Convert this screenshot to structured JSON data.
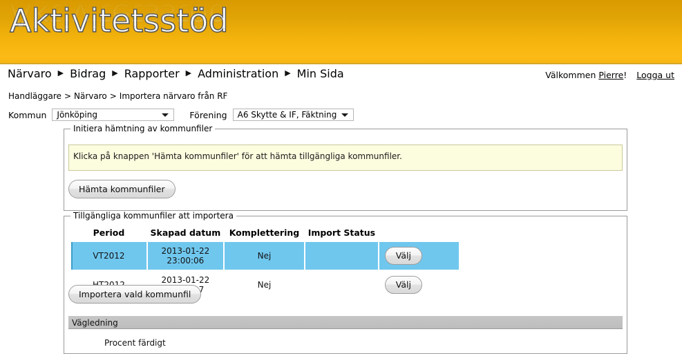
{
  "header": {
    "logo_text": "Aktivitetsstöd"
  },
  "nav": {
    "items": [
      {
        "label": "Närvaro"
      },
      {
        "label": "Bidrag"
      },
      {
        "label": "Rapporter"
      },
      {
        "label": "Administration"
      },
      {
        "label": "Min Sida"
      }
    ],
    "separator": "▶"
  },
  "account": {
    "welcome_prefix": "Välkommen ",
    "user_name": "Pierre",
    "welcome_suffix": "!",
    "logout_label": "Logga ut"
  },
  "breadcrumb": {
    "separator": ">",
    "items": [
      {
        "label": "Handläggare"
      },
      {
        "label": "Närvaro"
      },
      {
        "label": "Importera närvaro från RF"
      }
    ]
  },
  "filters": {
    "kommun_label": "Kommun",
    "kommun_value": "Jönköping",
    "forening_label": "Förening",
    "forening_value": "A6 Skytte & IF, Fäktning"
  },
  "initiera_section": {
    "legend": "Initiera hämtning av kommunfiler",
    "info_message": "Klicka på knappen 'Hämta kommunfiler' för att hämta tillgängliga kommunfiler.",
    "fetch_button": "Hämta kommunfiler"
  },
  "files_section": {
    "legend": "Tillgängliga kommunfiler att importera",
    "columns": [
      "Period",
      "Skapad datum",
      "Komplettering",
      "Import Status",
      ""
    ],
    "rows": [
      {
        "period": "VT2012",
        "datum_date": "2013-01-22",
        "datum_time": "23:00:06",
        "komplettering": "Nej",
        "import_status": "",
        "action_label": "Välj",
        "selected": true
      },
      {
        "period": "HT2012",
        "datum_date": "2013-01-22",
        "datum_time": "23:00:07",
        "komplettering": "Nej",
        "import_status": "",
        "action_label": "Välj",
        "selected": false
      }
    ],
    "import_button": "Importera vald kommunfil"
  },
  "guidance": {
    "title": "Vägledning",
    "percent_label": "Procent färdigt"
  },
  "colors": {
    "banner_top": "#d99a00",
    "banner_bottom": "#fcba16",
    "row_highlight": "#70c7ee",
    "info_bg": "#fcfcdf",
    "section_bar": "#c2c2c2"
  }
}
